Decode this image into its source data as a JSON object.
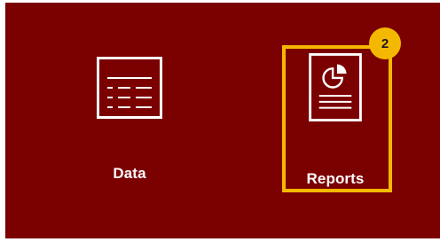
{
  "tiles": {
    "data": {
      "label": "Data",
      "icon": "table-list-icon"
    },
    "reports": {
      "label": "Reports",
      "icon": "report-pie-chart-icon"
    }
  },
  "step_badge": {
    "number": "2"
  },
  "colors": {
    "panel_background": "#7b0000",
    "highlight": "#f5b800",
    "icon_stroke": "#ffffff"
  }
}
